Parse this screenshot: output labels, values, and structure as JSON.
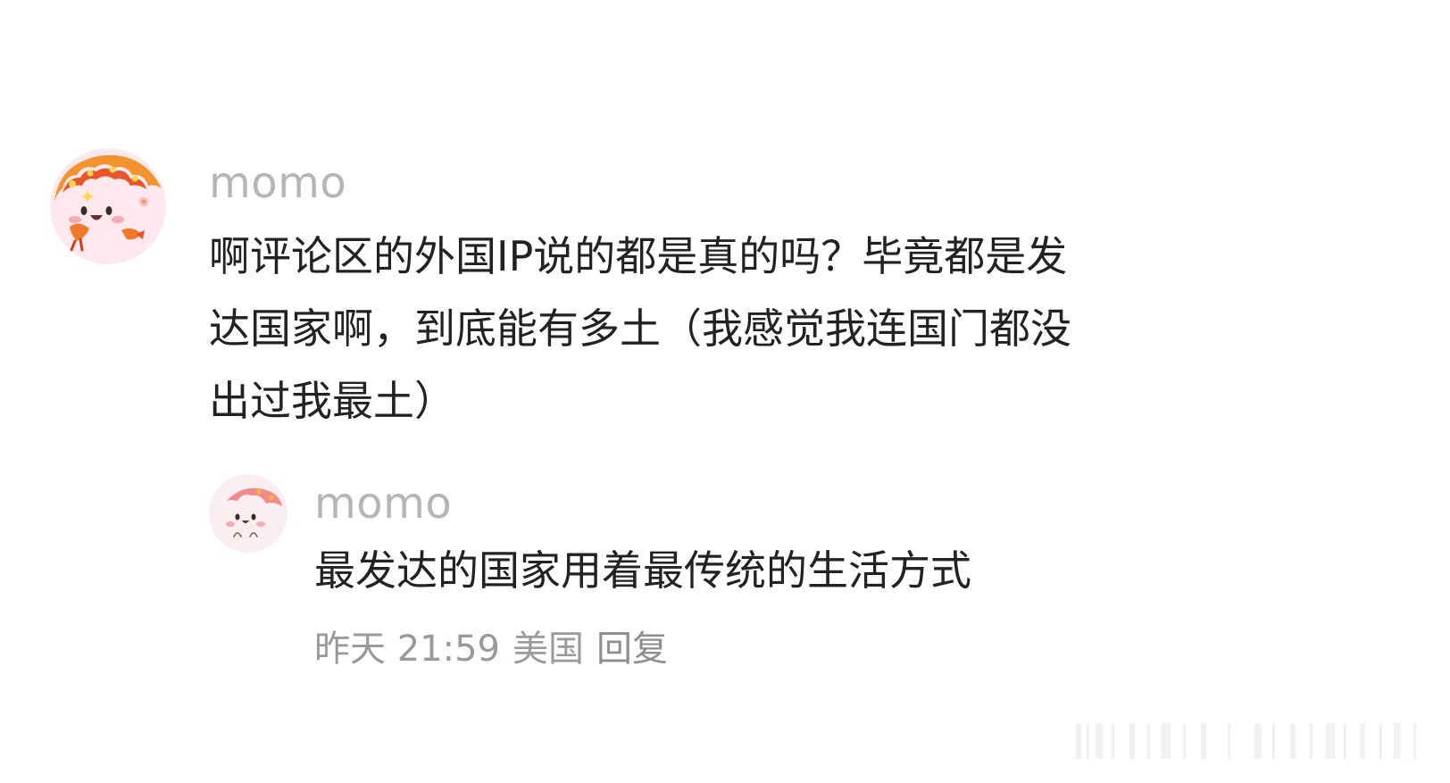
{
  "comment": {
    "username": "momo",
    "text_lines": [
      "啊评论区的外国IP说的都是真的吗？毕竟都是发",
      "达国家啊，到底能有多土（我感觉我连国门都没",
      "出过我最土）"
    ]
  },
  "reply": {
    "username": "momo",
    "text": "最发达的国家用着最传统的生活方式",
    "time": "昨天 21:59",
    "location": "美国",
    "reply_label": "回复"
  },
  "colors": {
    "username": "#b5b5b5",
    "text": "#222222",
    "meta": "#9a9a9a",
    "avatar_bg": "#fce8ec",
    "avatar_accent": "#f29a3c"
  },
  "icons": {
    "main_avatar": "cartoon-mascot-avatar",
    "reply_avatar": "cartoon-mascot-avatar"
  }
}
